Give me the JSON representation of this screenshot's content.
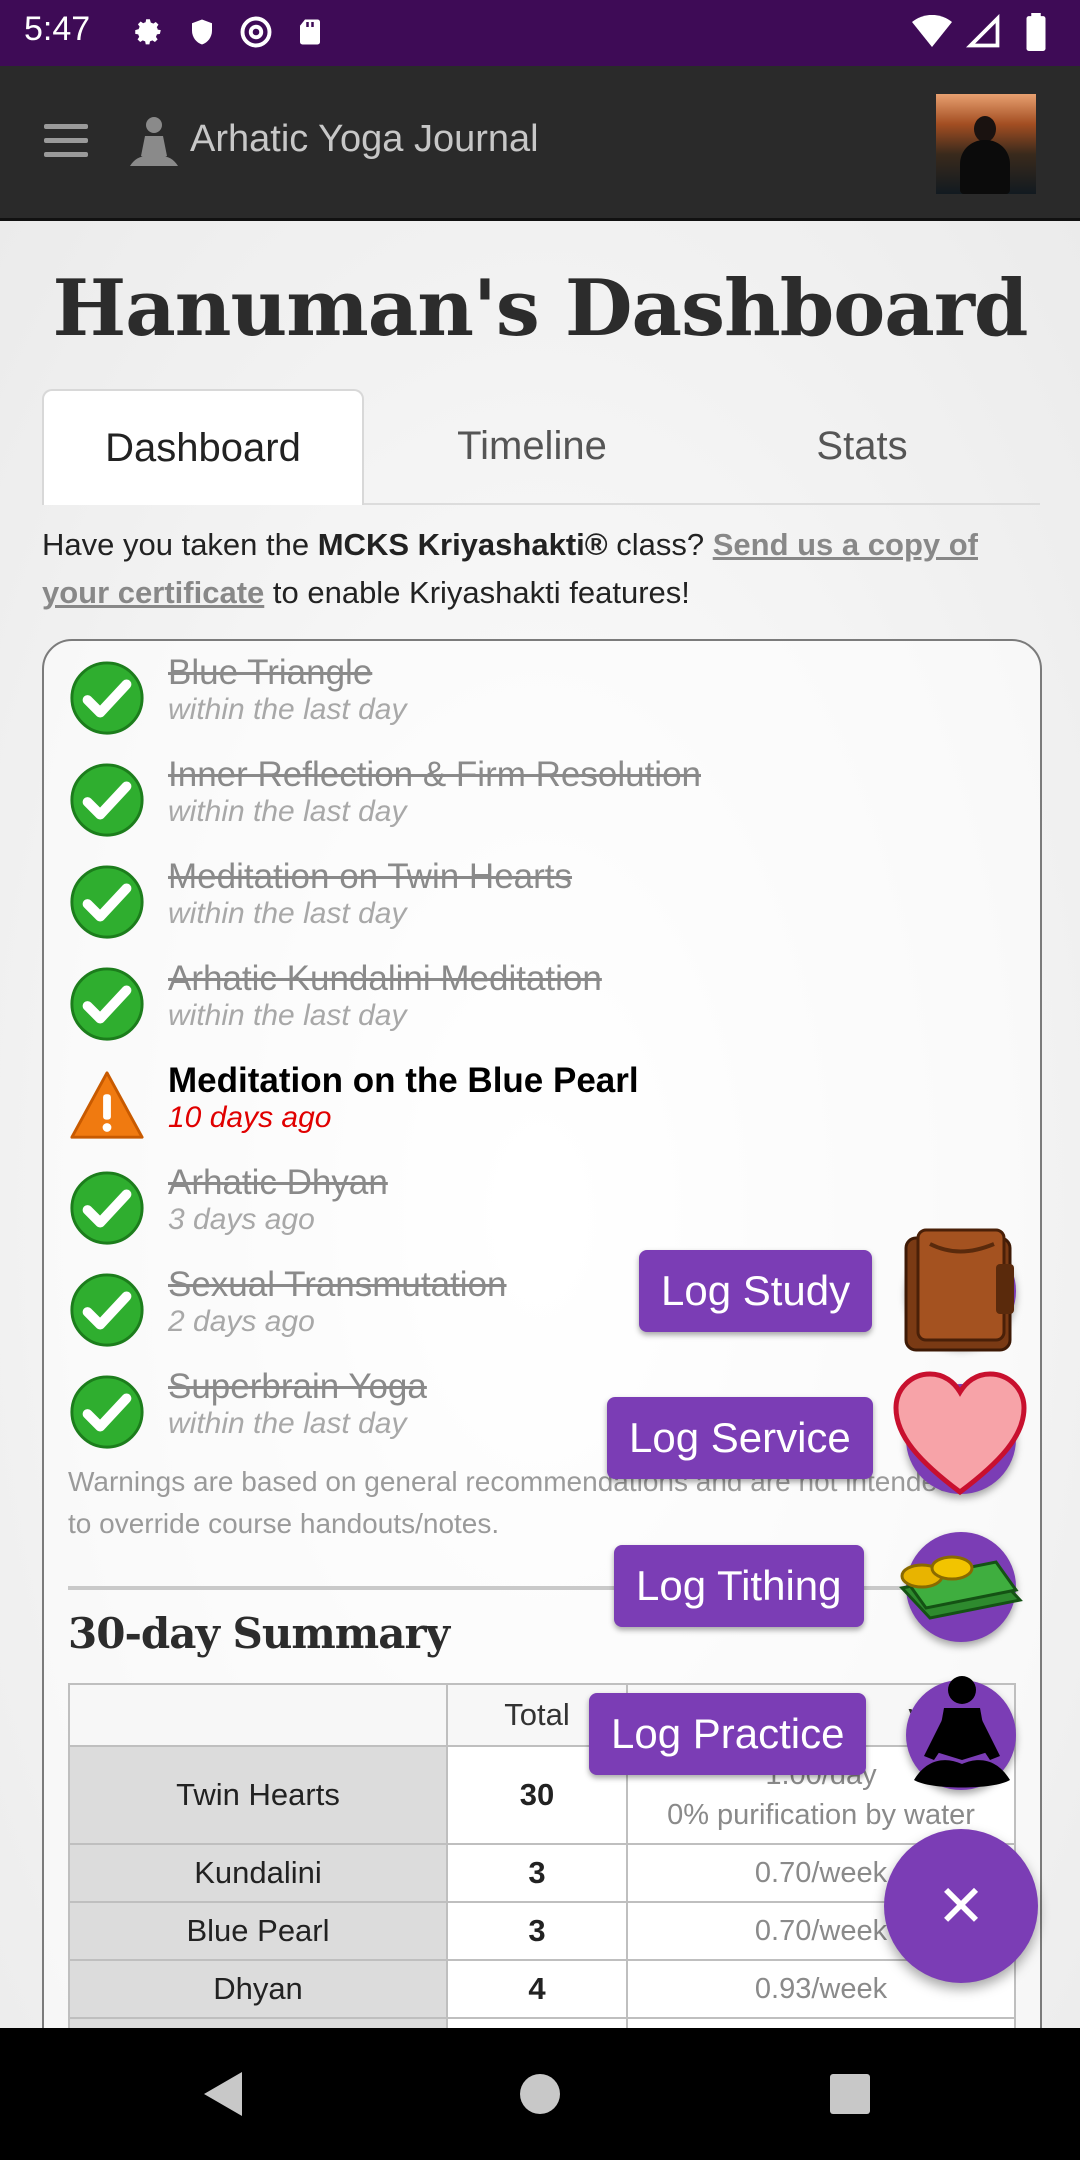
{
  "status_bar": {
    "time": "5:47",
    "left_icons": [
      "gear-icon",
      "shield-icon",
      "at-sign-icon",
      "sd-card-icon"
    ],
    "right_icons": [
      "wifi-icon",
      "signal-icon",
      "battery-icon"
    ]
  },
  "app_bar": {
    "title": "Arhatic Yoga Journal"
  },
  "page": {
    "title": "Hanuman's Dashboard"
  },
  "tabs": [
    {
      "label": "Dashboard",
      "active": true
    },
    {
      "label": "Timeline",
      "active": false
    },
    {
      "label": "Stats",
      "active": false
    }
  ],
  "notice": {
    "prefix": "Have you taken the ",
    "class_name": "MCKS Kriyashakti®",
    "middle": " class? ",
    "link": "Send us a copy of your certificate",
    "suffix": " to enable Kriyashakti features!"
  },
  "practices": [
    {
      "name": "Blue Triangle",
      "when": "within the last day",
      "status": "done"
    },
    {
      "name": "Inner Reflection & Firm Resolution",
      "when": "within the last day",
      "status": "done"
    },
    {
      "name": "Meditation on Twin Hearts",
      "when": "within the last day",
      "status": "done"
    },
    {
      "name": "Arhatic Kundalini Meditation",
      "when": "within the last day",
      "status": "done"
    },
    {
      "name": "Meditation on the Blue Pearl",
      "when": "10 days ago",
      "status": "warning"
    },
    {
      "name": "Arhatic Dhyan",
      "when": "3 days ago",
      "status": "done"
    },
    {
      "name": "Sexual Transmutation",
      "when": "2 days ago",
      "status": "done"
    },
    {
      "name": "Superbrain Yoga",
      "when": "within the last day",
      "status": "done"
    }
  ],
  "disclaimer": "Warnings are based on general recommendations and are not intended to override course handouts/notes.",
  "summary": {
    "title": "30-day Summary",
    "headers": [
      "",
      "Total",
      "y"
    ],
    "rows": [
      {
        "name": "Twin Hearts",
        "total": "30",
        "freq": "1.00/day",
        "note": "0% purification by water"
      },
      {
        "name": "Kundalini",
        "total": "3",
        "freq": "0.70/week"
      },
      {
        "name": "Blue Pearl",
        "total": "3",
        "freq": "0.70/week"
      },
      {
        "name": "Dhyan",
        "total": "4",
        "freq": "0.93/week"
      }
    ]
  },
  "fab_actions": [
    {
      "label": "Log Study",
      "icon": "book-icon"
    },
    {
      "label": "Log Service",
      "icon": "heart-icon"
    },
    {
      "label": "Log Tithing",
      "icon": "money-icon"
    },
    {
      "label": "Log Practice",
      "icon": "meditation-icon"
    }
  ],
  "fab_main": {
    "symbol": "✕",
    "icon": "close-icon"
  },
  "colors": {
    "status_bar": "#3e0b56",
    "app_bar": "#2a2a2a",
    "accent": "#7b3db5",
    "warning_text": "#e00000",
    "done_green": "#2fae2f",
    "warning_orange": "#f07a10"
  }
}
